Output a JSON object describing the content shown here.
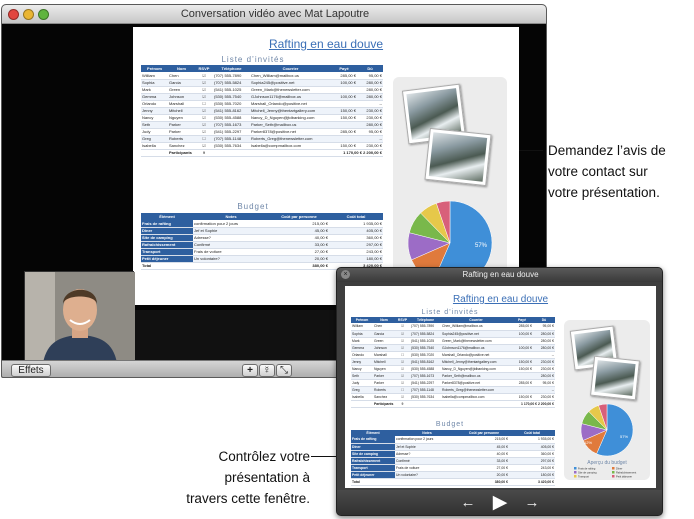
{
  "main_window": {
    "title": "Conversation vidéo avec Mat Lapoutre",
    "effects_label": "Effets",
    "toolbar": {
      "add": "+",
      "mic": "☿",
      "fullscreen": "⤡"
    }
  },
  "presentation": {
    "title": "Rafting en eau douve",
    "guests_heading": "Liste d’invités",
    "guest_headers": [
      "Prénom",
      "Nom",
      "RSVP",
      "Téléphone",
      "Courrier",
      "Payé",
      "Dû"
    ],
    "guests": [
      [
        "William",
        "Chen",
        "☑",
        "(707) 555-7890",
        "Chen_William@mailbox.us",
        "285,00 €",
        "95,00 €"
      ],
      [
        "Sophia",
        "Garcia",
        "☑",
        "(707) 555-5824",
        "Sophia245@positive.net",
        "100,00 €",
        "280,00 €"
      ],
      [
        "Mark",
        "Green",
        "☑",
        "(541) 555-1025",
        "Green_Mark@thenewsletter.com",
        "",
        "280,00 €"
      ],
      [
        "Gemma",
        "Johnson",
        "☑",
        "(530) 555-7540",
        "GJohnson1176@mailbox.us",
        "100,00 €",
        "280,00 €"
      ],
      [
        "Orlando",
        "Marshall",
        "☐",
        "(530) 555-7020",
        "Marshall_Orlando@positive.net",
        "",
        "--"
      ],
      [
        "Jenny",
        "Mitchell",
        "☑",
        "(541) 555-8162",
        "Mitchell_Jenny@thentartgallery.com",
        "150,00 €",
        "230,00 €"
      ],
      [
        "Nancy",
        "Nguyen",
        "☑",
        "(530) 555-4588",
        "Nancy_D_Nguyen@jtdbanking.com",
        "150,00 €",
        "230,00 €"
      ],
      [
        "Seth",
        "Parker",
        "☑",
        "(707) 555-1673",
        "Parker_Seth@mailbox.us",
        "",
        "280,00 €"
      ],
      [
        "Judy",
        "Parker",
        "☑",
        "(541) 555-2297",
        "Parker8378@positive.net",
        "285,00 €",
        "95,00 €"
      ],
      [
        "Greg",
        "Roberts",
        "☐",
        "(707) 555-1148",
        "Roberts_Greg@thenewsletter.com",
        "",
        "--"
      ],
      [
        "Isabella",
        "Sanchez",
        "☑",
        "(530) 555-7634",
        "Isabella@compmailbox.com",
        "150,00 €",
        "230,00 €"
      ]
    ],
    "participants_label": "Participants",
    "participants_count": "9",
    "participants_total": "1 170,00 € 2 200,00 €",
    "budget_heading": "Budget",
    "budget_headers": [
      "Élément",
      "Notes",
      "Coût par personne",
      "Coût total"
    ],
    "budget_rows": [
      [
        "Frais de rafting",
        "confirmation pour 2 jours",
        "215,00 €",
        "1 935,00 €"
      ],
      [
        "Dîner",
        "Jef et Sophie",
        "45,00 €",
        "405,00 €"
      ],
      [
        "Site de camping",
        "Adresse?",
        "40,00 €",
        "360,00 €"
      ],
      [
        "Rafraîchissement",
        "Confirmé",
        "33,00 €",
        "297,00 €"
      ],
      [
        "Transport",
        "Frais de voiture",
        "27,00 €",
        "243,00 €"
      ],
      [
        "Petit déjeuner",
        "Un volontaire?",
        "20,00 €",
        "180,00 €"
      ]
    ],
    "budget_total_label": "Total",
    "budget_total_value": "380,00 €",
    "budget_grand_total": "3 420,00 €",
    "pie_percent_main": "57%",
    "pie_percent_small": "12%",
    "pie_caption": "Aperçu du budget",
    "pie_legend": [
      "Frais de rafting",
      "Dîner",
      "Site de camping",
      "Rafraîchissement",
      "Transport",
      "Petit déjeuner"
    ],
    "pie_colors": [
      "#3f8fd8",
      "#e07a3c",
      "#9c6cc6",
      "#79b84b",
      "#e6c84a",
      "#d8607a"
    ]
  },
  "control_window": {
    "title": "Rafting en eau douve",
    "prev_label": "←",
    "play_label": "▶",
    "next_label": "→"
  },
  "callouts": {
    "top": [
      "Demandez l’avis de",
      "votre contact sur",
      "votre présentation."
    ],
    "bottom": [
      "Contrôlez votre",
      "présentation à",
      "travers cette fenêtre."
    ]
  }
}
